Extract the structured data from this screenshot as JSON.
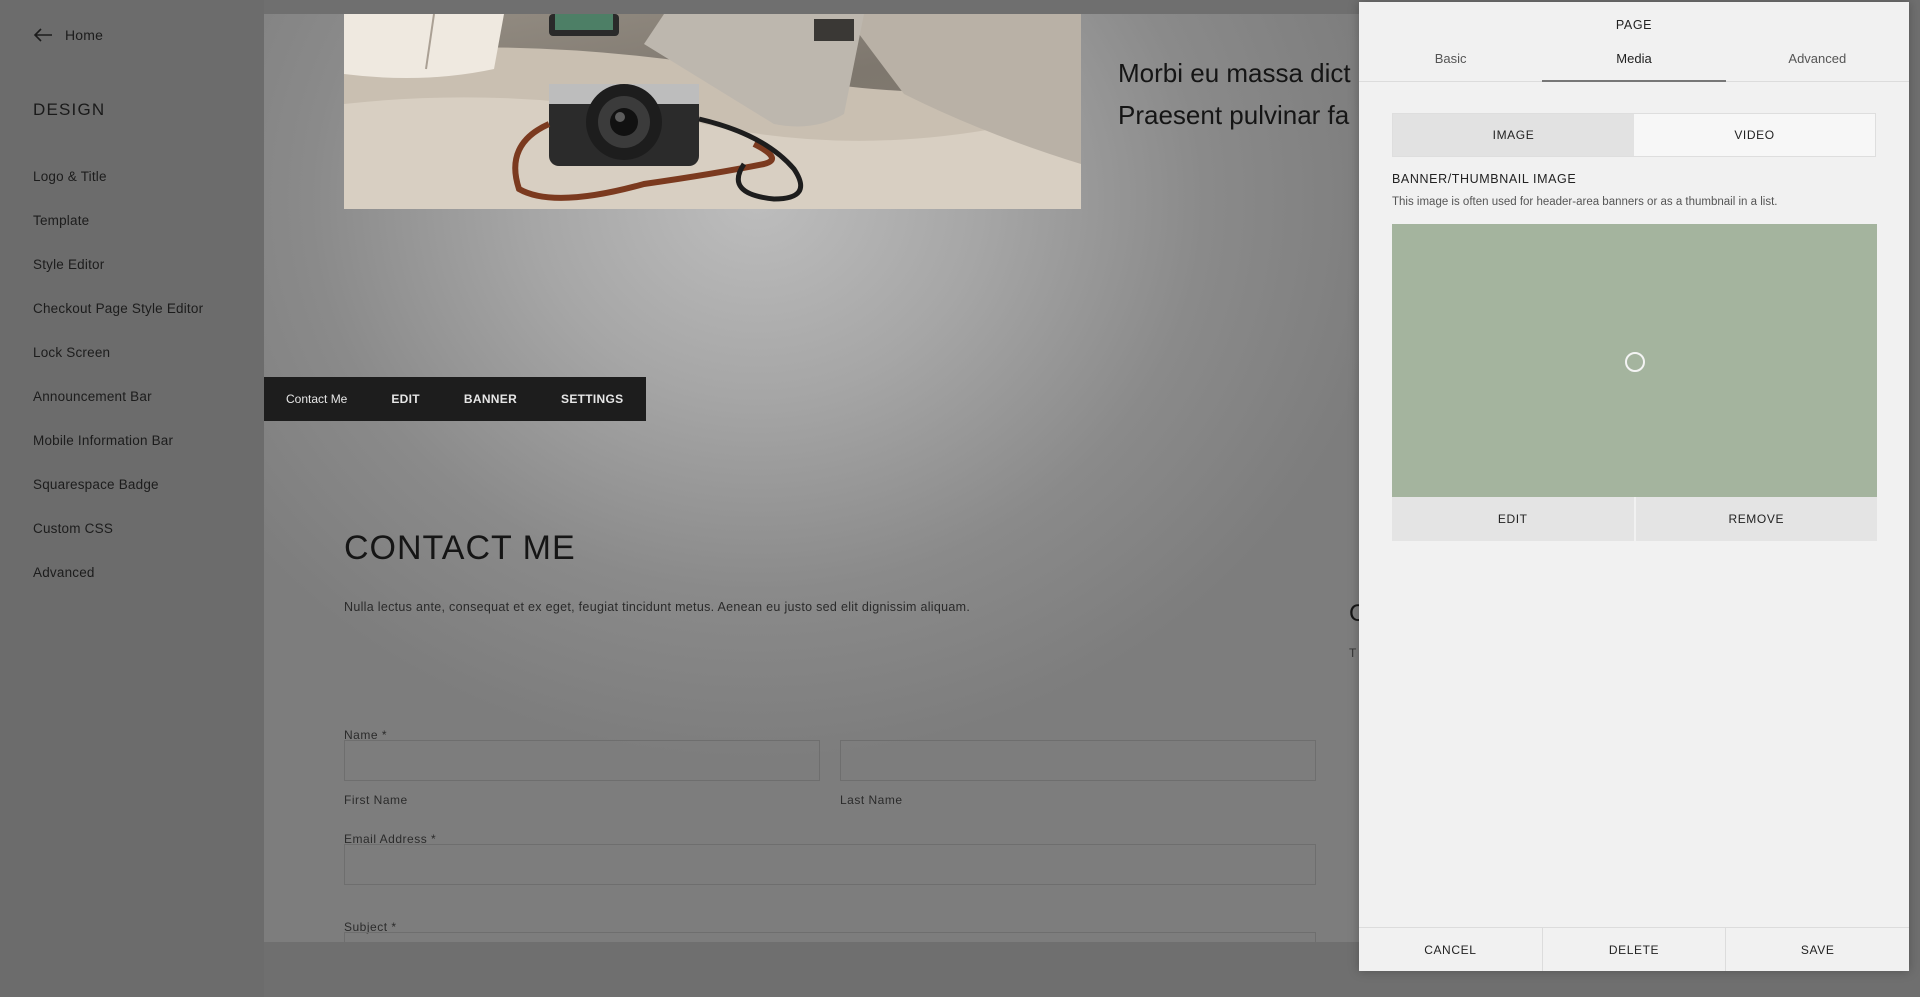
{
  "sidebar": {
    "home_label": "Home",
    "heading": "DESIGN",
    "items": [
      {
        "label": "Logo & Title"
      },
      {
        "label": "Template"
      },
      {
        "label": "Style Editor"
      },
      {
        "label": "Checkout Page Style Editor"
      },
      {
        "label": "Lock Screen"
      },
      {
        "label": "Announcement Bar"
      },
      {
        "label": "Mobile Information Bar"
      },
      {
        "label": "Squarespace Badge"
      },
      {
        "label": "Custom CSS"
      },
      {
        "label": "Advanced"
      }
    ]
  },
  "preview": {
    "hero_text_line1": "Morbi eu massa dict",
    "hero_text_line2": "Praesent pulvinar fa",
    "toolbar": {
      "page_name": "Contact Me",
      "edit": "EDIT",
      "banner": "BANNER",
      "settings": "SETTINGS"
    },
    "contact_title": "CONTACT ME",
    "contact_description": "Nulla lectus ante, consequat et ex eget, feugiat tincidunt metus. Aenean eu justo sed elit dignissim aliquam.",
    "form": {
      "name_label": "Name *",
      "first_name_label": "First Name",
      "last_name_label": "Last Name",
      "email_label": "Email Address *",
      "subject_label": "Subject *"
    },
    "partial_right_heading": "C",
    "partial_right_text": "T"
  },
  "panel": {
    "title": "PAGE",
    "tabs": [
      {
        "label": "Basic",
        "active": false
      },
      {
        "label": "Media",
        "active": true
      },
      {
        "label": "Advanced",
        "active": false
      }
    ],
    "media_toggle": {
      "image": "IMAGE",
      "video": "VIDEO",
      "selected": "IMAGE"
    },
    "banner_heading": "BANNER/THUMBNAIL IMAGE",
    "banner_help": "This image is often used for header-area banners or as a thumbnail in a list.",
    "banner_color": "#a4b49e",
    "banner_edit": "EDIT",
    "banner_remove": "REMOVE",
    "footer": {
      "cancel": "CANCEL",
      "delete": "DELETE",
      "save": "SAVE"
    }
  }
}
